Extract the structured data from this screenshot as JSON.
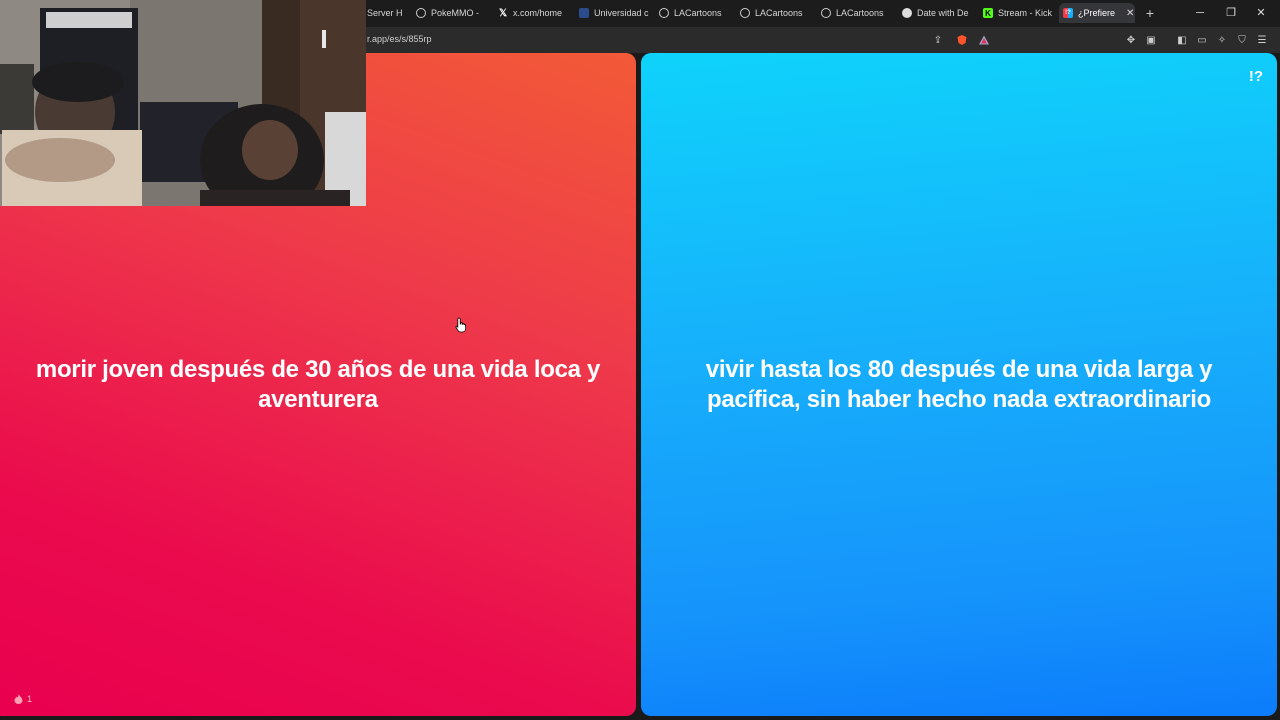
{
  "tabs": [
    {
      "label": "Server H",
      "icon": "server-icon"
    },
    {
      "label": "PokeMMO - ",
      "icon": "globe-icon"
    },
    {
      "label": "x.com/home",
      "icon": "x-logo-icon"
    },
    {
      "label": "Universidad c",
      "icon": "university-icon"
    },
    {
      "label": "LACartoons",
      "icon": "globe-icon"
    },
    {
      "label": "LACartoons",
      "icon": "globe-icon"
    },
    {
      "label": "LACartoons",
      "icon": "globe-icon"
    },
    {
      "label": "Date with De",
      "icon": "globe-icon"
    },
    {
      "label": "Stream - Kick",
      "icon": "kick-icon"
    },
    {
      "label": "¿Prefiere",
      "icon": "prefieres-icon",
      "active": true
    }
  ],
  "address": {
    "url": "r.app/es/s/855rp"
  },
  "options": {
    "left": "morir joven después de 30 años de una vida loca y aventurera",
    "right": "vivir hasta los 80 después de una vida larga y pacífica, sin haber hecho nada extraordinario"
  },
  "logo_text": "!?",
  "fire_count": "1",
  "colors": {
    "left_panel_top": "#f25a37",
    "left_panel_bottom": "#e9004f",
    "right_panel_top": "#0fd3fb",
    "right_panel_bottom": "#0c7cfb",
    "chrome_bg": "#1c1c1c"
  }
}
